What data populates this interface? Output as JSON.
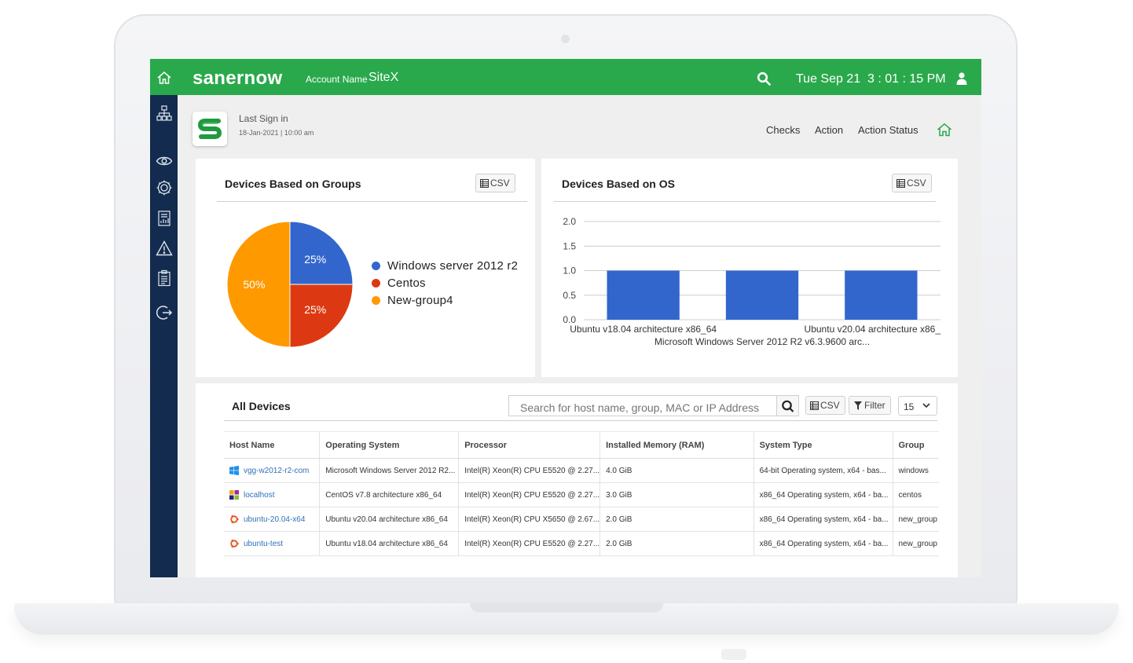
{
  "header": {
    "brand": "sanernow",
    "account_label": "Account Name",
    "account_value": "SiteX",
    "datetime": "Tue Sep 21  3 : 01 : 15 PM"
  },
  "sidebar": {
    "icons": [
      "sitemap-icon",
      "eye-icon",
      "settings-icon",
      "report-icon",
      "alert-icon",
      "clipboard-icon",
      "logout-icon"
    ]
  },
  "profile": {
    "last_sign_label": "Last Sign in",
    "last_sign_date": "18-Jan-2021 | 10:00 am"
  },
  "topnav": [
    "Checks",
    "Action",
    "Action Status"
  ],
  "groups_card": {
    "title": "Devices Based on Groups",
    "csv_label": "CSV"
  },
  "os_card": {
    "title": "Devices Based on OS",
    "csv_label": "CSV"
  },
  "chart_data": [
    {
      "type": "pie",
      "labels": [
        "Windows server 2012 r2",
        "Centos",
        "New-group4"
      ],
      "values": [
        25,
        25,
        50
      ],
      "value_labels": [
        "25%",
        "25%",
        "50%"
      ],
      "colors": [
        "#3366cc",
        "#dc3912",
        "#ff9900"
      ],
      "legend": "right"
    },
    {
      "type": "bar",
      "categories": [
        "Ubuntu v18.04 architecture x86_64",
        "Microsoft Windows Server 2012 R2 v6.3.9600 arc...",
        "Ubuntu v20.04 architecture x86_"
      ],
      "values": [
        1,
        1,
        1
      ],
      "color": "#3366cc",
      "ylim": [
        0,
        2
      ],
      "yticks": [
        "0.0",
        "0.5",
        "1.0",
        "1.5",
        "2.0"
      ],
      "grid": true
    }
  ],
  "devices": {
    "title": "All Devices",
    "search_placeholder": "Search for host name, group, MAC or IP Address",
    "csv_label": "CSV",
    "filter_label": "Filter",
    "page_size": "15",
    "columns": [
      "Host Name",
      "Operating System",
      "Processor",
      "Installed Memory (RAM)",
      "System Type",
      "Group"
    ],
    "rows": [
      {
        "icon": "windows-icon",
        "host": "vgg-w2012-r2-com",
        "os": "Microsoft Windows Server 2012 R2...",
        "cpu": "Intel(R) Xeon(R) CPU E5520 @ 2.27...",
        "ram": "4.0 GiB",
        "type": "64-bit Operating system, x64 - bas...",
        "group": "windows"
      },
      {
        "icon": "centos-icon",
        "host": "localhost",
        "os": "CentOS v7.8 architecture x86_64",
        "cpu": "Intel(R) Xeon(R) CPU E5520 @ 2.27...",
        "ram": "3.0 GiB",
        "type": "x86_64 Operating system, x64 - ba...",
        "group": "centos"
      },
      {
        "icon": "ubuntu-icon",
        "host": "ubuntu-20.04-x64",
        "os": "Ubuntu v20.04 architecture x86_64",
        "cpu": "Intel(R) Xeon(R) CPU X5650 @ 2.67...",
        "ram": "2.0 GiB",
        "type": "x86_64 Operating system, x64 - ba...",
        "group": "new_group"
      },
      {
        "icon": "ubuntu-icon",
        "host": "ubuntu-test",
        "os": "Ubuntu v18.04 architecture x86_64",
        "cpu": "Intel(R) Xeon(R) CPU E5520 @ 2.27...",
        "ram": "2.0 GiB",
        "type": "x86_64 Operating system, x64 - ba...",
        "group": "new_group"
      }
    ]
  }
}
